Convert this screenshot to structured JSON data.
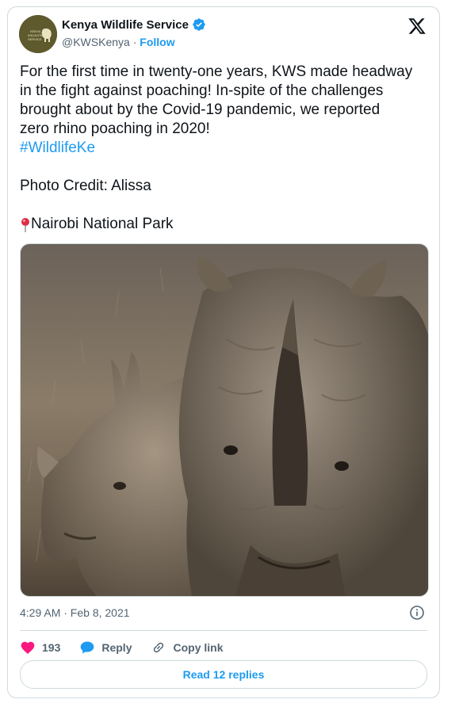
{
  "author": {
    "name": "Kenya Wildlife Service",
    "handle": "@KWSKenya",
    "separator": "·",
    "follow_label": "Follow",
    "avatar_text": "KENYA WILDLIFE SERVICE"
  },
  "tweet": {
    "lines": [
      "For the first time in twenty-one years, KWS made headway",
      "in the fight against poaching! In-spite of the challenges",
      "brought about by the Covid-19 pandemic, we reported",
      "zero rhino poaching in 2020!"
    ],
    "hashtag": "#WildlifeKe",
    "photo_credit": "Photo Credit: Alissa",
    "location": "Nairobi National Park"
  },
  "meta": {
    "timestamp": "4:29 AM · Feb 8, 2021"
  },
  "actions": {
    "like_count": "193",
    "reply_label": "Reply",
    "copy_link_label": "Copy link"
  },
  "read_replies_label": "Read 12 replies",
  "colors": {
    "accent": "#1d9bf0",
    "like": "#f91880",
    "text": "#0f1419",
    "muted": "#536471",
    "border": "#cfd9de"
  },
  "icons": [
    "verified-badge-icon",
    "x-logo-icon",
    "pin-icon",
    "info-icon",
    "heart-icon",
    "reply-bubble-icon",
    "link-icon"
  ]
}
